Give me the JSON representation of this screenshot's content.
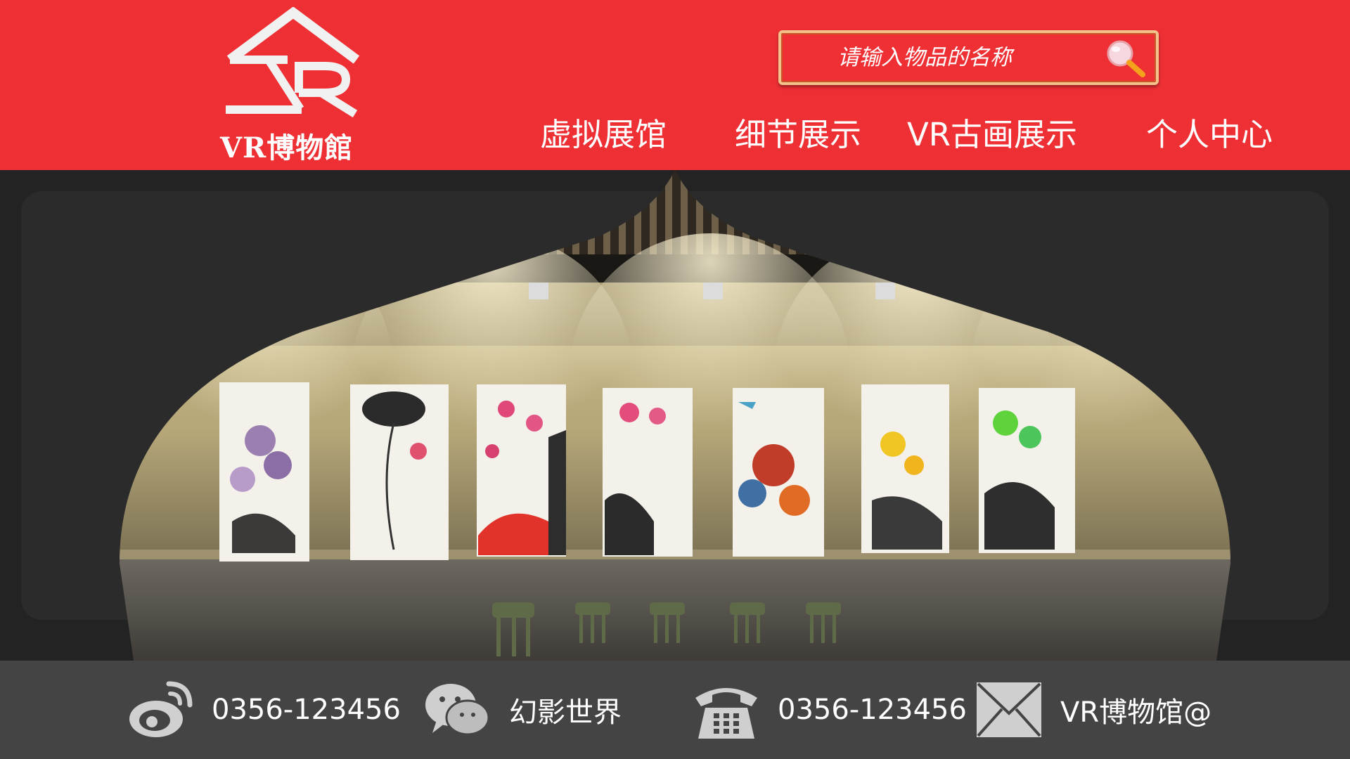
{
  "brand": {
    "logo_text": "VR博物館",
    "accent_color": "#ee3035"
  },
  "search": {
    "placeholder": "请输入物品的名称",
    "icon": "magnifier-icon"
  },
  "nav": {
    "items": [
      {
        "label": "虚拟展馆"
      },
      {
        "label": "细节展示"
      },
      {
        "label": "VR古画展示"
      },
      {
        "label": "个人中心"
      }
    ]
  },
  "hero": {
    "paintings": [
      {
        "subject": "purple flowers"
      },
      {
        "subject": "lotus ink"
      },
      {
        "subject": "pink lotus with red rock"
      },
      {
        "subject": "pink lotus with rock"
      },
      {
        "subject": "chrysanthemums"
      },
      {
        "subject": "yellow flowers"
      },
      {
        "subject": "green flowers with rock"
      }
    ]
  },
  "footer": {
    "contacts": [
      {
        "icon": "weibo-icon",
        "text": "0356-123456"
      },
      {
        "icon": "wechat-icon",
        "text": "幻影世界"
      },
      {
        "icon": "telephone-icon",
        "text": "0356-123456"
      },
      {
        "icon": "mail-icon",
        "text": "VR博物馆@"
      }
    ]
  }
}
